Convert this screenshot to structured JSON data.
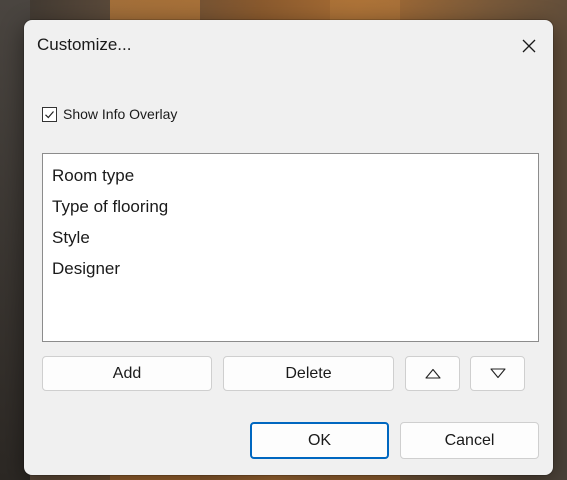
{
  "dialog": {
    "title": "Customize...",
    "close_icon": "close-icon"
  },
  "overlay": {
    "checkbox_label": "Show Info Overlay",
    "checked": true
  },
  "list": {
    "items": [
      {
        "label": "Room type"
      },
      {
        "label": "Type of flooring"
      },
      {
        "label": "Style"
      },
      {
        "label": "Designer"
      }
    ]
  },
  "buttons": {
    "add": "Add",
    "delete": "Delete",
    "move_up_icon": "triangle-up-icon",
    "move_down_icon": "triangle-down-icon",
    "ok": "OK",
    "cancel": "Cancel"
  },
  "colors": {
    "accent": "#0067c0",
    "dialog_bg": "#f0f0f0"
  }
}
